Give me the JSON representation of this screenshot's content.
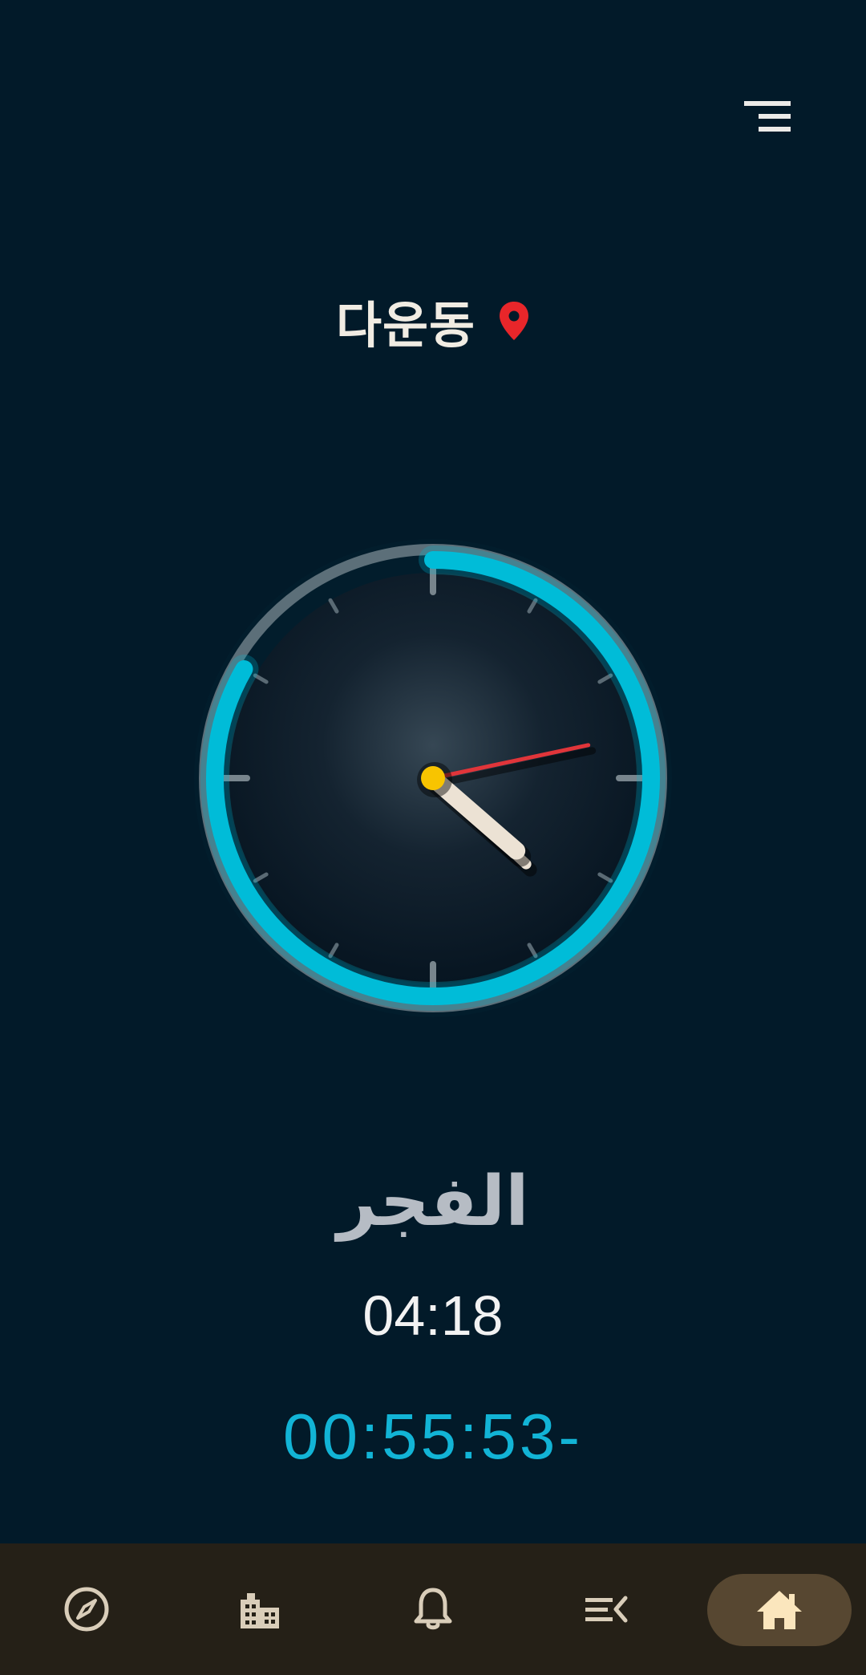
{
  "header": {
    "menu_icon": "menu-lines-icon"
  },
  "location": {
    "name": "다운동",
    "pin_icon": "location-pin-icon",
    "pin_color": "#e8262a"
  },
  "clock": {
    "hour": 4,
    "minute": 22,
    "second": 7,
    "progress_arc": {
      "start_minute": 0,
      "end_minute": 50,
      "color": "#00bcd8"
    },
    "center_color": "#f8c400",
    "second_hand_color": "#e0353a",
    "hand_color": "#ece2d4"
  },
  "prayer": {
    "name": "الفجر",
    "time": "04:18",
    "countdown": "00:55:53-"
  },
  "bottom_nav": {
    "items": [
      {
        "icon": "compass-icon",
        "active": false
      },
      {
        "icon": "mosque-building-icon",
        "active": false
      },
      {
        "icon": "bell-icon",
        "active": false
      },
      {
        "icon": "list-collapse-icon",
        "active": false
      },
      {
        "icon": "home-icon",
        "active": true
      }
    ],
    "active_bg": "#574731",
    "icon_color": "#d9cdb9",
    "active_icon_color": "#fbe6bd"
  }
}
